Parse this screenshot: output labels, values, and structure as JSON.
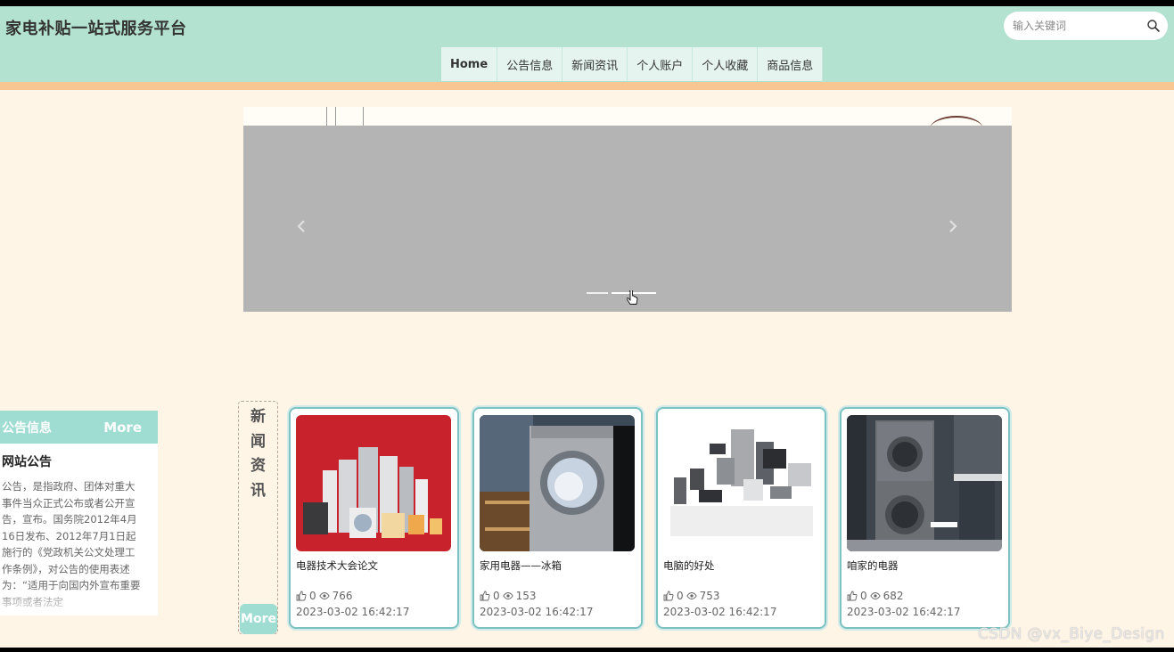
{
  "header": {
    "site_title": "家电补贴一站式服务平台",
    "search_placeholder": "输入关键词",
    "nav": [
      {
        "label": "Home"
      },
      {
        "label": "公告信息"
      },
      {
        "label": "新闻资讯"
      },
      {
        "label": "个人账户"
      },
      {
        "label": "个人收藏"
      },
      {
        "label": "商品信息"
      }
    ]
  },
  "carousel": {
    "prev_icon": "chevron-left-icon",
    "next_icon": "chevron-right-icon",
    "slide_count": 3,
    "active_index": 1
  },
  "notice": {
    "header": "公告信息",
    "more": "More",
    "title": "网站公告",
    "body": "公告，是指政府、团体对重大事件当众正式公布或者公开宣告，宣布。国务院2012年4月16日发布、2012年7月1日起施行的《党政机关公文处理工作条例》，对公告的使用表述为：“适用于向国内外宣布重要事项或者法定"
  },
  "news": {
    "title_chars": [
      "新",
      "闻",
      "资",
      "讯"
    ],
    "more": "More",
    "cards": [
      {
        "title": "电器技术大会论文",
        "likes": "0",
        "views": "766",
        "date": "2023-03-02 16:42:17",
        "image": "appliances-red-image"
      },
      {
        "title": "家用电器——冰箱",
        "likes": "0",
        "views": "153",
        "date": "2023-03-02 16:42:17",
        "image": "washing-machine-image"
      },
      {
        "title": "电脑的好处",
        "likes": "0",
        "views": "753",
        "date": "2023-03-02 16:42:17",
        "image": "electronics-group-image"
      },
      {
        "title": "咱家的电器",
        "likes": "0",
        "views": "682",
        "date": "2023-03-02 16:42:17",
        "image": "stacked-washer-image"
      }
    ]
  },
  "watermark": "CSDN @vx_Biye_Design",
  "colors": {
    "header_bg": "#b3e2d0",
    "accent_stripe": "#f8c691",
    "page_bg": "#fff5e7",
    "teal_accent": "#9fdcd2",
    "card_border": "#7cc2c0"
  }
}
